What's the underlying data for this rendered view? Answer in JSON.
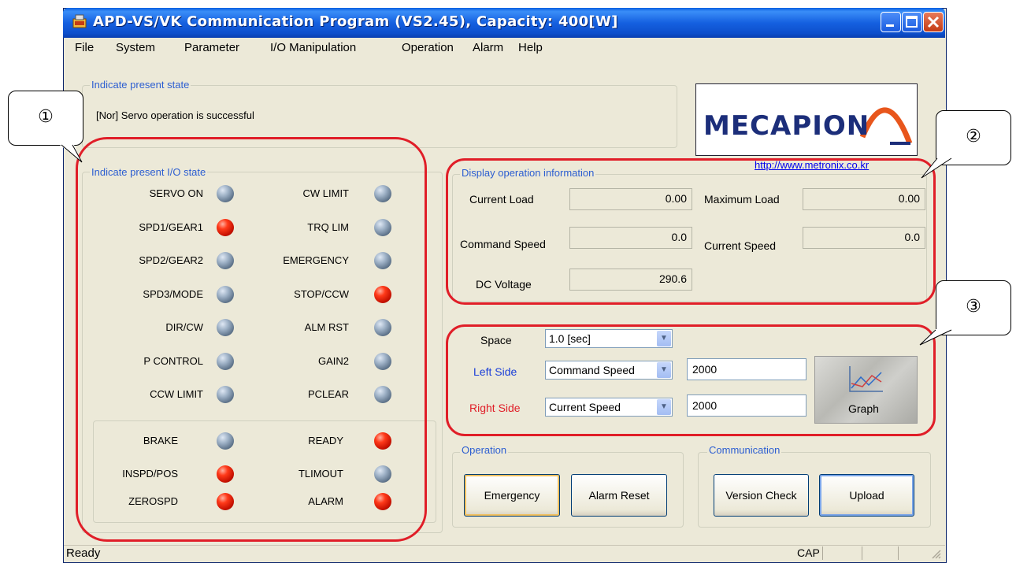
{
  "window": {
    "title": "APD-VS/VK Communication Program (VS2.45), Capacity:  400[W]"
  },
  "menu": [
    "File",
    "System",
    "Parameter",
    "I/O Manipulation",
    "Operation",
    "Alarm",
    "Help"
  ],
  "present_state": {
    "group_label": "Indicate present state",
    "message": "[Nor] Servo operation is successful"
  },
  "logo": {
    "text": "MECAPION",
    "url": "http://www.metronix.co.kr"
  },
  "io_state": {
    "group_label": "Indicate present I/O state",
    "inputs_left": [
      {
        "label": "SERVO ON",
        "on": false
      },
      {
        "label": "SPD1/GEAR1",
        "on": true
      },
      {
        "label": "SPD2/GEAR2",
        "on": false
      },
      {
        "label": "SPD3/MODE",
        "on": false
      },
      {
        "label": "DIR/CW",
        "on": false
      },
      {
        "label": "P CONTROL",
        "on": false
      },
      {
        "label": "CCW LIMIT",
        "on": false
      }
    ],
    "inputs_right": [
      {
        "label": "CW LIMIT",
        "on": false
      },
      {
        "label": "TRQ LIM",
        "on": false
      },
      {
        "label": "EMERGENCY",
        "on": false
      },
      {
        "label": "STOP/CCW",
        "on": true
      },
      {
        "label": "ALM RST",
        "on": false
      },
      {
        "label": "GAIN2",
        "on": false
      },
      {
        "label": "PCLEAR",
        "on": false
      }
    ],
    "outputs_left": [
      {
        "label": "BRAKE",
        "on": false
      },
      {
        "label": "INSPD/POS",
        "on": true
      },
      {
        "label": "ZEROSPD",
        "on": true
      }
    ],
    "outputs_right": [
      {
        "label": "READY",
        "on": true
      },
      {
        "label": "TLIMOUT",
        "on": false
      },
      {
        "label": "ALARM",
        "on": true
      }
    ]
  },
  "operation_info": {
    "group_label": "Display operation information",
    "current_load_label": "Current Load",
    "current_load": "0.00",
    "maximum_load_label": "Maximum Load",
    "maximum_load": "0.00",
    "command_speed_label": "Command Speed",
    "command_speed": "0.0",
    "current_speed_label": "Current Speed",
    "current_speed": "0.0",
    "dc_voltage_label": "DC Voltage",
    "dc_voltage": "290.6"
  },
  "graph_settings": {
    "space_label": "Space",
    "space_value": "1.0 [sec]",
    "left_label": "Left Side",
    "left_value": "Command Speed",
    "left_scale": "2000",
    "right_label": "Right Side",
    "right_value": "Current Speed",
    "right_scale": "2000",
    "graph_button": "Graph",
    "left_color": "#1a3ed8",
    "right_color": "#e01e28"
  },
  "operation": {
    "group_label": "Operation",
    "emergency": "Emergency",
    "alarm_reset": "Alarm Reset"
  },
  "communication": {
    "group_label": "Communication",
    "version_check": "Version Check",
    "upload": "Upload"
  },
  "statusbar": {
    "text": "Ready",
    "cap": "CAP"
  },
  "callouts": [
    "①",
    "②",
    "③"
  ]
}
